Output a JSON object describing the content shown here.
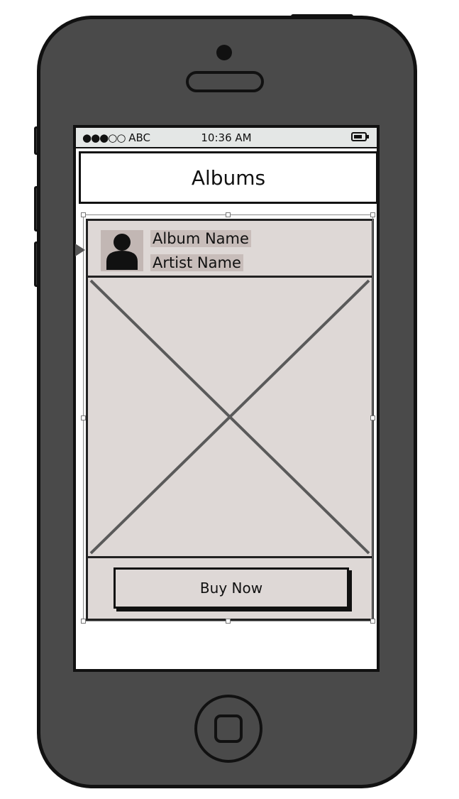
{
  "status_bar": {
    "signal": "●●●○○",
    "carrier": "ABC",
    "time": "10:36 AM"
  },
  "nav": {
    "title": "Albums"
  },
  "card": {
    "album_name": "Album Name",
    "artist_name": "Artist Name",
    "buy_label": "Buy Now"
  },
  "icons": {
    "avatar": "person-icon",
    "battery": "battery-icon",
    "image": "image-placeholder-icon",
    "home": "home-button-icon"
  },
  "colors": {
    "phone_body": "#4a4a4a",
    "card_background": "#ded8d6",
    "status_bar": "#e4e7e6",
    "text_highlight": "#c8bdba"
  }
}
